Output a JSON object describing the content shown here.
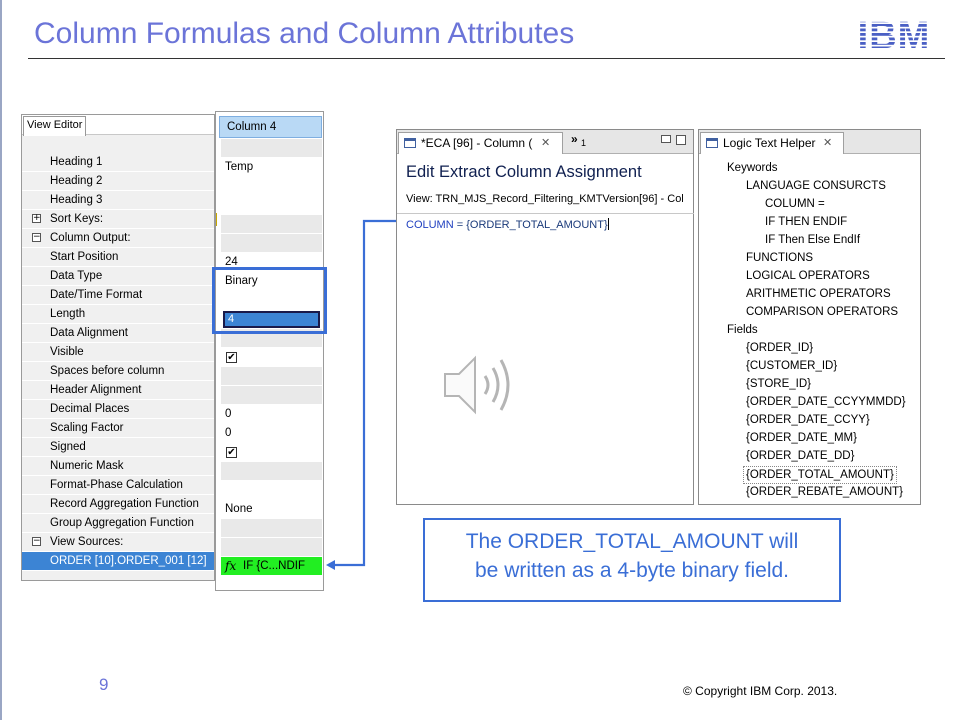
{
  "slide": {
    "title": "Column Formulas and Column Attributes",
    "page_number": "9",
    "copyright": "© Copyright  IBM Corp. 2013.",
    "logo": "IBM"
  },
  "view_editor": {
    "tab": "View Editor",
    "rows": [
      {
        "label": "Heading 1",
        "expander": ""
      },
      {
        "label": "Heading 2",
        "expander": ""
      },
      {
        "label": "Heading 3",
        "expander": ""
      },
      {
        "label": "Sort Keys:",
        "expander": "+"
      },
      {
        "label": "Column Output:",
        "expander": "−"
      },
      {
        "label": "Start Position",
        "expander": ""
      },
      {
        "label": "Data Type",
        "expander": ""
      },
      {
        "label": "Date/Time Format",
        "expander": ""
      },
      {
        "label": "Length",
        "expander": ""
      },
      {
        "label": "Data Alignment",
        "expander": ""
      },
      {
        "label": "Visible",
        "expander": ""
      },
      {
        "label": "Spaces before column",
        "expander": ""
      },
      {
        "label": "Header Alignment",
        "expander": ""
      },
      {
        "label": "Decimal Places",
        "expander": ""
      },
      {
        "label": "Scaling Factor",
        "expander": ""
      },
      {
        "label": "Signed",
        "expander": ""
      },
      {
        "label": "Numeric Mask",
        "expander": ""
      },
      {
        "label": "Format-Phase Calculation",
        "expander": ""
      },
      {
        "label": "Record Aggregation Function",
        "expander": ""
      },
      {
        "label": "Group Aggregation Function",
        "expander": ""
      },
      {
        "label": "View Sources:",
        "expander": "−"
      },
      {
        "label": "ORDER [10].ORDER_001 [12]",
        "expander": ""
      }
    ]
  },
  "column": {
    "header": "Column 4",
    "values": {
      "heading1": "Temp",
      "start_position": "24",
      "data_type": "Binary",
      "length": "4",
      "visible_check": "✔",
      "decimal_places": "0",
      "scaling_factor": "0",
      "signed_check": "✔",
      "record_aggregation": "None",
      "view_source_formula": "IF {C...NDIF",
      "formula_icon": "fx"
    }
  },
  "editor": {
    "tab_title": "*ECA [96] - Column (",
    "more_tabs": "»",
    "more_count": "1",
    "heading": "Edit Extract Column Assignment",
    "view_line": "View: TRN_MJS_Record_Filtering_KMTVersion[96] - Col",
    "code_keyword": "COLUMN",
    "code_rest": " = {ORDER_TOTAL_AMOUNT}"
  },
  "helper": {
    "tab_title": "Logic Text Helper",
    "items": [
      {
        "text": "Keywords",
        "level": 0
      },
      {
        "text": "LANGUAGE CONSURCTS",
        "level": 1
      },
      {
        "text": "COLUMN =",
        "level": 2
      },
      {
        "text": "IF THEN ENDIF",
        "level": 2
      },
      {
        "text": "IF Then Else EndIf",
        "level": 2
      },
      {
        "text": "FUNCTIONS",
        "level": 1
      },
      {
        "text": "LOGICAL OPERATORS",
        "level": 1
      },
      {
        "text": "ARITHMETIC OPERATORS",
        "level": 1
      },
      {
        "text": "COMPARISON OPERATORS",
        "level": 1
      },
      {
        "text": "Fields",
        "level": 0
      },
      {
        "text": "{ORDER_ID}",
        "level": 1
      },
      {
        "text": "{CUSTOMER_ID}",
        "level": 1
      },
      {
        "text": "{STORE_ID}",
        "level": 1
      },
      {
        "text": "{ORDER_DATE_CCYYMMDD}",
        "level": 1
      },
      {
        "text": "{ORDER_DATE_CCYY}",
        "level": 1
      },
      {
        "text": "{ORDER_DATE_MM}",
        "level": 1
      },
      {
        "text": "{ORDER_DATE_DD}",
        "level": 1
      },
      {
        "text": "{ORDER_TOTAL_AMOUNT}",
        "level": 1,
        "selected": true
      },
      {
        "text": "{ORDER_REBATE_AMOUNT}",
        "level": 1
      }
    ]
  },
  "callout": {
    "line1": "The ORDER_TOTAL_AMOUNT  will",
    "line2": "be written as a 4-byte binary field."
  },
  "colors": {
    "title": "#6b74d8",
    "accent_blue": "#3a6ed6",
    "selection": "#3c84d4",
    "formula_green": "#22ee22"
  },
  "icons": [
    "ibm-logo",
    "speaker-icon",
    "window-icon",
    "close-icon",
    "formula-icon",
    "checkbox-icon",
    "expand-icon",
    "collapse-icon"
  ]
}
